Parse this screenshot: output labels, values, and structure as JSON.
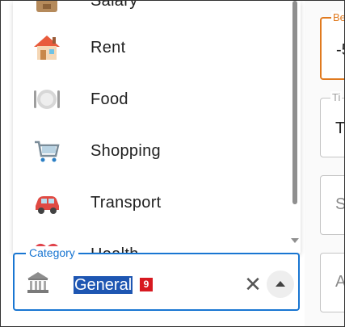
{
  "dropdown": {
    "items": [
      {
        "label": "Salary",
        "icon": "money-bag-icon"
      },
      {
        "label": "Rent",
        "icon": "house-icon"
      },
      {
        "label": "Food",
        "icon": "plate-icon"
      },
      {
        "label": "Shopping",
        "icon": "shopping-cart-icon"
      },
      {
        "label": "Transport",
        "icon": "car-icon"
      },
      {
        "label": "Health",
        "icon": "heart-icon"
      }
    ]
  },
  "category_field": {
    "label": "Category",
    "value": "General",
    "badge": "9",
    "icon": "bank-icon",
    "clear_symbol": "✕"
  },
  "right_form": {
    "amount_label": "Be",
    "amount_value": "-5",
    "title_label": "Ti",
    "title_value": "T",
    "field3_value": "S",
    "field4_value": "A"
  },
  "colors": {
    "accent": "#1976d2",
    "amount_border": "#e07a1f",
    "selection": "#1e56b2",
    "badge": "#d71920"
  }
}
